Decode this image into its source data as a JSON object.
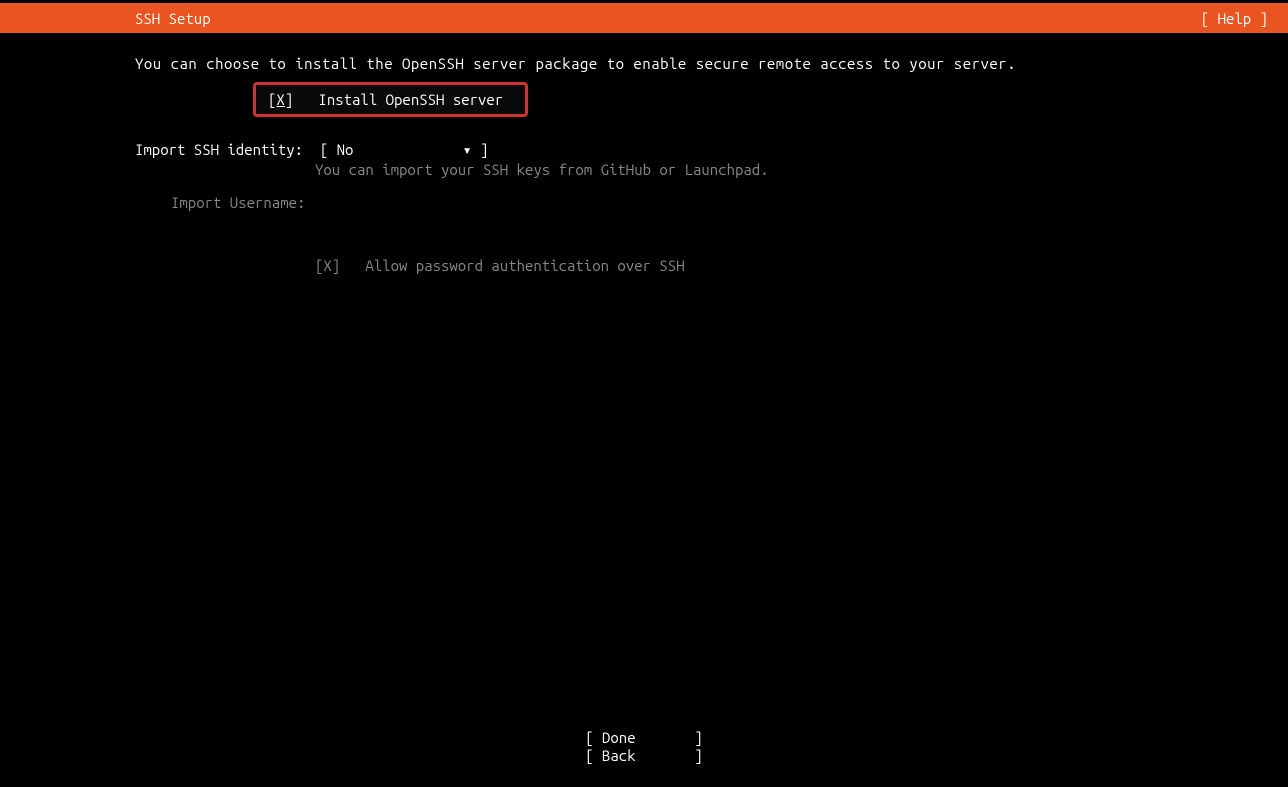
{
  "header": {
    "title": "SSH Setup",
    "help": "[ Help ]"
  },
  "description": "You can choose to install the OpenSSH server package to enable secure remote access to your server.",
  "install_checkbox": {
    "bracket_open": "[",
    "mark": "X",
    "bracket_close": "]",
    "label": "Install OpenSSH server"
  },
  "import_identity": {
    "label": "Import SSH identity:  ",
    "bracket_open": "[ ",
    "value": "No",
    "spacer": "             ",
    "arrow": "▾",
    "bracket_close": " ]",
    "hint": "You can import your SSH keys from GitHub or Launchpad."
  },
  "username": {
    "label": "Import Username:"
  },
  "password_auth": {
    "checkbox": "[X]",
    "label": "Allow password authentication over SSH"
  },
  "footer": {
    "done": "[ Done       ]",
    "back": "[ Back       ]"
  }
}
